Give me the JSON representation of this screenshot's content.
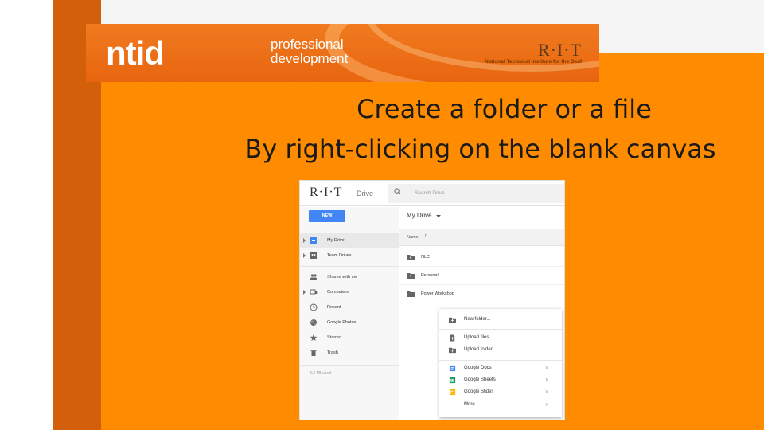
{
  "banner": {
    "logo": "ntid",
    "tagline_line1": "professional",
    "tagline_line2": "development",
    "rit": "R·I·T",
    "ntid_full": "National Technical Institute for the Deaf"
  },
  "slide": {
    "title_line1": "Create a folder or a file",
    "title_line2": "By right-clicking on the blank canvas"
  },
  "drive": {
    "logo": "R·I·T",
    "logo_sub": "Drive",
    "search_placeholder": "Search Drive",
    "new_label": "NEW",
    "sidebar": {
      "items": [
        {
          "label": "My Drive",
          "icon": "drive-icon"
        },
        {
          "label": "Team Drives",
          "icon": "team-drives-icon"
        },
        {
          "label": "Shared with me",
          "icon": "people-icon"
        },
        {
          "label": "Computers",
          "icon": "computer-icon"
        },
        {
          "label": "Recent",
          "icon": "clock-icon"
        },
        {
          "label": "Google Photos",
          "icon": "pinwheel-icon"
        },
        {
          "label": "Starred",
          "icon": "star-icon"
        },
        {
          "label": "Trash",
          "icon": "trash-icon"
        }
      ],
      "storage": "3.3 TB used"
    },
    "main": {
      "title": "My Drive",
      "column_name": "Name",
      "files": [
        {
          "name": "NLC",
          "icon": "shared-folder-icon"
        },
        {
          "name": "Personal",
          "icon": "shared-folder-icon"
        },
        {
          "name": "Power Workshop",
          "icon": "folder-icon"
        }
      ]
    },
    "context_menu": {
      "items": [
        {
          "label": "New folder...",
          "icon": "new-folder-icon"
        },
        {
          "label": "Upload files...",
          "icon": "upload-file-icon"
        },
        {
          "label": "Upload folder...",
          "icon": "upload-folder-icon"
        },
        {
          "label": "Google Docs",
          "icon": "docs-icon",
          "color": "#4285f4"
        },
        {
          "label": "Google Sheets",
          "icon": "sheets-icon",
          "color": "#0f9d58"
        },
        {
          "label": "Google Slides",
          "icon": "slides-icon",
          "color": "#f4b400"
        },
        {
          "label": "More",
          "icon": ""
        }
      ]
    }
  },
  "colors": {
    "left_bar": "#d35f0b",
    "slide_bg": "#ff8c00",
    "accent_blue": "#4285f4"
  }
}
